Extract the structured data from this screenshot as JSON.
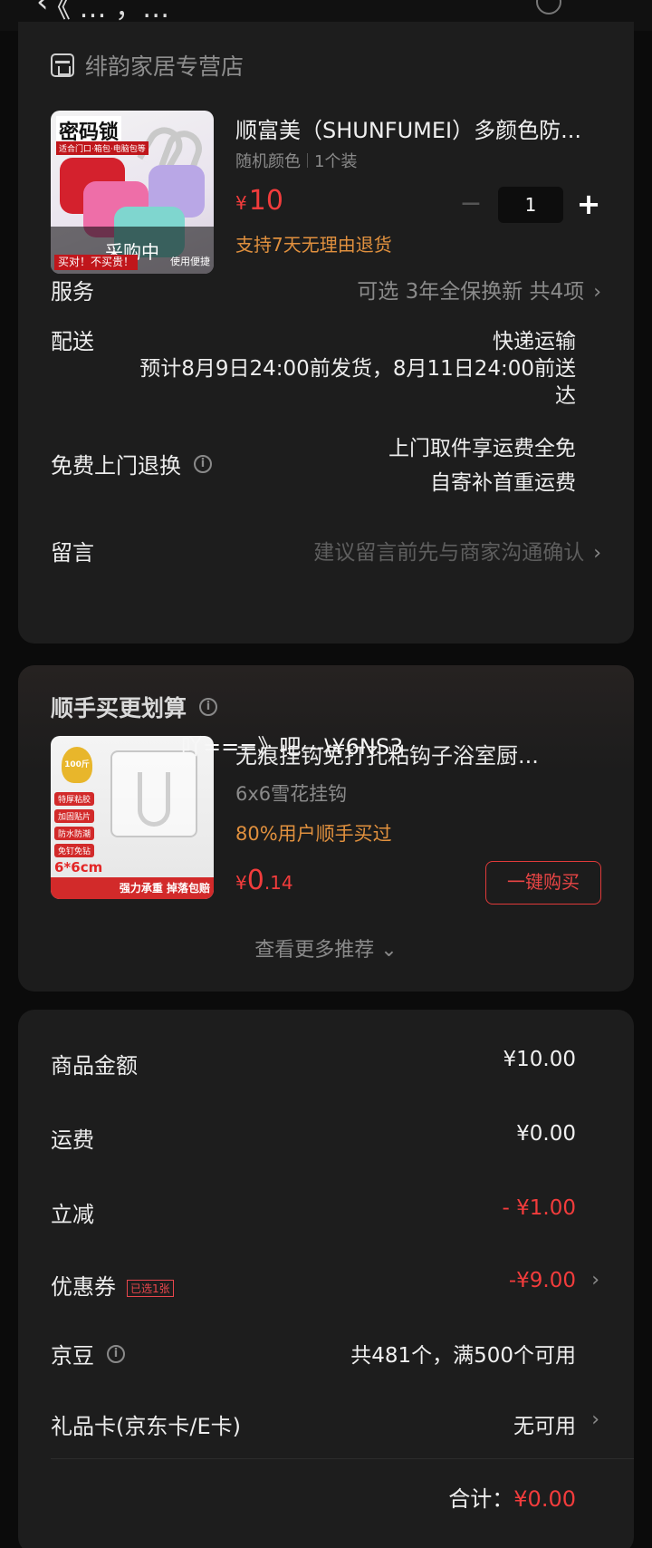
{
  "top_cut_title": "《 … ，…",
  "store": {
    "name": "绯韵家居专营店"
  },
  "product": {
    "thumb_title": "密码锁",
    "thumb_sub": "适合门口·箱包·电脑包等",
    "thumb_status": "采购中",
    "thumb_promo_left": "买对！不买贵！",
    "thumb_promo_right": "使用便捷",
    "title": "顺富美（SHUNFUMEI）多颜色防...",
    "spec_color": "随机颜色",
    "spec_pack": "1个装",
    "price_symbol": "¥",
    "price": "10",
    "quantity": "1",
    "minus": "−",
    "plus": "+",
    "return_note": "支持7天无理由退货"
  },
  "service": {
    "label": "服务",
    "value": "可选 3年全保换新 共4项"
  },
  "delivery": {
    "label": "配送",
    "method": "快递运输",
    "eta_line1": "预计8月9日24:00前发货，8月11日24:00前送",
    "eta_line2": "达"
  },
  "free_return": {
    "label": "免费上门退换",
    "line1": "上门取件享运费全免",
    "line2": "自寄补首重运费"
  },
  "message": {
    "label": "留言",
    "placeholder": "建议留言前先与商家沟通确认"
  },
  "chevron": "›",
  "info_mark": "i",
  "recommend": {
    "title": "顺手买更划算",
    "overlay_text": "吖===》吧---\\¥6NS3",
    "thumb_badge": "100斤",
    "thumb_tags": [
      "特厚粘胶",
      "加固贴片",
      "防水防潮",
      "免钉免钻"
    ],
    "thumb_size": "6*6cm",
    "thumb_bar": "强力承重 掉落包赔",
    "item_title": "无痕挂钩免打孔粘钩子浴室厨...",
    "item_spec": "6x6雪花挂钩",
    "item_note": "80%用户顺手买过",
    "price_symbol": "¥",
    "price_int": "0",
    "price_dec": ".14",
    "buy_label": "一键购买",
    "more_label": "查看更多推荐 ⌄"
  },
  "summary": {
    "goods_label": "商品金额",
    "goods_value": "¥10.00",
    "shipping_label": "运费",
    "shipping_value": "¥0.00",
    "discount_label": "立减",
    "discount_value": "- ¥1.00",
    "coupon_label": "优惠券",
    "coupon_tag": "已选1张",
    "coupon_value": "-¥9.00",
    "jd_bean_label": "京豆",
    "jd_bean_value": "共481个，满500个可用",
    "gift_card_label": "礼品卡(京东卡/E卡)",
    "gift_card_value": "无可用",
    "total_label": "合计：",
    "total_value": "¥0.00"
  }
}
